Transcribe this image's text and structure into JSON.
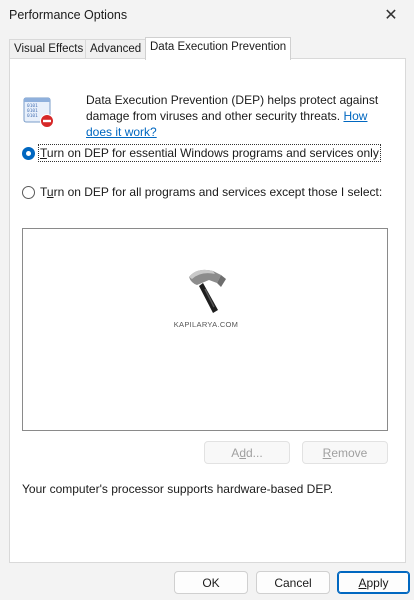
{
  "window": {
    "title": "Performance Options",
    "close_glyph": "✕"
  },
  "tabs": [
    {
      "label": "Visual Effects",
      "active": false
    },
    {
      "label": "Advanced",
      "active": false
    },
    {
      "label": "Data Execution Prevention",
      "active": true
    }
  ],
  "dep": {
    "icon": "dep-shield-icon",
    "description": "Data Execution Prevention (DEP) helps protect against damage from viruses and other security threats. ",
    "link_text": "How does it work?",
    "options": [
      {
        "pre": "",
        "ul": "T",
        "post": "urn on DEP for essential Windows programs and services only",
        "checked": true
      },
      {
        "pre": "T",
        "ul": "u",
        "post": "rn on DEP for all programs and services except those I select:",
        "checked": false
      }
    ],
    "watermark": "KAPILARYA.COM",
    "add_button": {
      "ul": "d",
      "pre": "A",
      "post": "d..."
    },
    "remove_button": {
      "ul": "R",
      "pre": "",
      "post": "emove"
    },
    "status": "Your computer's processor supports hardware-based DEP."
  },
  "footer": {
    "ok": "OK",
    "cancel": "Cancel",
    "apply": {
      "ul": "A",
      "post": "pply"
    }
  },
  "colors": {
    "accent": "#0067c0",
    "link": "#0067c0"
  }
}
